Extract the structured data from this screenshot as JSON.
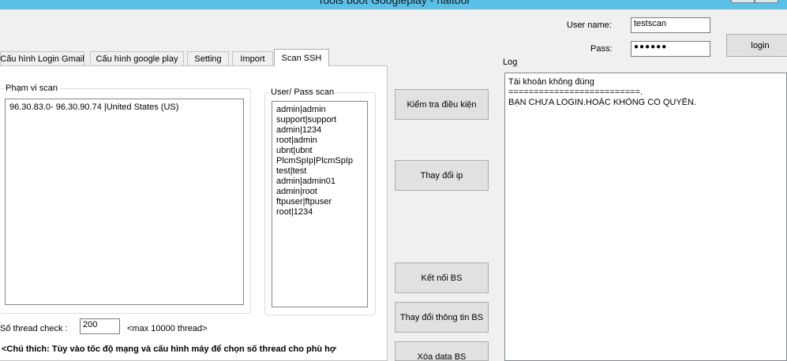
{
  "window": {
    "title": "Tools boot Googleplay - haitool"
  },
  "login": {
    "username_label": "User name:",
    "username_value": "testscan",
    "pass_label": "Pass:",
    "pass_value": "●●●●●●",
    "login_button": "login"
  },
  "tabs": [
    {
      "label": "Cấu hình Login Gmail"
    },
    {
      "label": "Cấu hình google play"
    },
    {
      "label": "Setting"
    },
    {
      "label": "Import"
    },
    {
      "label": "Scan SSH"
    }
  ],
  "scan_ssh": {
    "range_group_label": "Phạm vi scan",
    "range_lines": [
      "96.30.83.0- 96.30.90.74 |United States (US)"
    ],
    "userpass_group_label": "User/ Pass scan",
    "userpass_lines": [
      "admin|admin",
      "support|support",
      "admin|1234",
      "root|admin",
      "ubnt|ubnt",
      "PlcmSpIp|PlcmSpIp",
      "test|test",
      "admin|admin01",
      "admin|root",
      "ftpuser|ftpuser",
      "root|1234"
    ],
    "thread_label": "Số thread check :",
    "thread_value": "200",
    "thread_max": "<max 10000 thread>",
    "note": "<Chú thích: Tùy vào tốc độ mạng và cấu hình máy để chọn số thread cho phù hợ"
  },
  "actions": {
    "check_conditions": "Kiểm tra điều kiện",
    "change_ip": "Thay đổi ip",
    "connect_bs": "Kết nối BS",
    "change_bs_info": "Thay đổi thông tin BS",
    "delete_bs_data": "Xóa data BS"
  },
  "log": {
    "label": "Log",
    "lines": [
      "Tài khoản không đúng",
      "==========================.",
      "BẠN CHƯA LOGIN.HOẶC KHÔNG CÓ QUYỀN."
    ]
  }
}
